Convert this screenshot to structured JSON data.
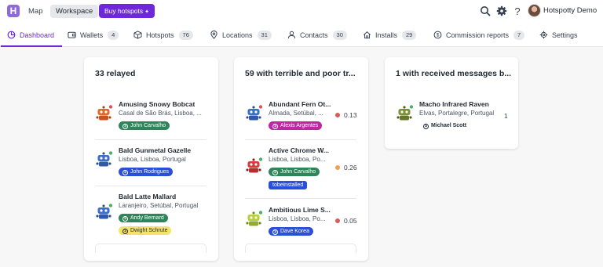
{
  "header": {
    "logo_letter": "H",
    "nav_map": "Map",
    "nav_workspace": "Workspace",
    "buy_button": "Buy hotspots",
    "user_name": "Hotspotty Demo"
  },
  "tabs": [
    {
      "label": "Dashboard",
      "count": "",
      "icon": "dashboard-icon"
    },
    {
      "label": "Wallets",
      "count": "4",
      "icon": "wallet-icon"
    },
    {
      "label": "Hotspots",
      "count": "76",
      "icon": "cube-icon"
    },
    {
      "label": "Locations",
      "count": "31",
      "icon": "location-pin-icon"
    },
    {
      "label": "Contacts",
      "count": "30",
      "icon": "user-icon"
    },
    {
      "label": "Installs",
      "count": "29",
      "icon": "home-icon"
    },
    {
      "label": "Commission reports",
      "count": "7",
      "icon": "dollar-circle-icon"
    },
    {
      "label": "Settings",
      "count": "",
      "icon": "gear-icon"
    }
  ],
  "colors": {
    "accent": "#6d28d9",
    "tag_green": "#2f855a",
    "tag_blue": "#2b50d8",
    "tag_magenta": "#c026a0",
    "tag_yellow": "#f4e36b",
    "dot_red": "#dc5a5a",
    "dot_orange": "#f0a050"
  },
  "cards": [
    {
      "title": "33 relayed",
      "items": [
        {
          "name": "Amusing Snowy Bobcat",
          "location": "Casal de São Brás, Lisboa, ...",
          "tags": [
            "John Carvalho"
          ],
          "robot": "orange"
        },
        {
          "name": "Bald Gunmetal Gazelle",
          "location": "Lisboa, Lisboa, Portugal",
          "tags": [
            "John Rodrigues"
          ],
          "robot": "blue"
        },
        {
          "name": "Bald Latte Mallard",
          "location": "Laranjeiro, Setúbal, Portugal",
          "tags": [
            "Andy Bernard",
            "Dwight Schrute"
          ],
          "robot": "blue"
        }
      ]
    },
    {
      "title": "59 with terrible and poor tr...",
      "items": [
        {
          "name": "Abundant Fern Ot...",
          "location": "Almada, Setúbal, ...",
          "tags": [
            "Alexis Argentes"
          ],
          "score": "0.13",
          "robot": "blue"
        },
        {
          "name": "Active Chrome W...",
          "location": "Lisboa, Lisboa, Po...",
          "tags": [
            "John Carvalho",
            "tobeinstalled"
          ],
          "score": "0.26",
          "robot": "red"
        },
        {
          "name": "Ambitious Lime S...",
          "location": "Lisboa, Lisboa, Po...",
          "tags": [
            "Dave Korea"
          ],
          "score": "0.05",
          "robot": "lime"
        }
      ]
    },
    {
      "title": "1 with received messages b...",
      "items": [
        {
          "name": "Macho Infrared Raven",
          "location": "Elvas, Portalegre, Portugal",
          "tags": [
            "Michael Scott"
          ],
          "score": "1",
          "robot": "olive"
        }
      ]
    }
  ]
}
